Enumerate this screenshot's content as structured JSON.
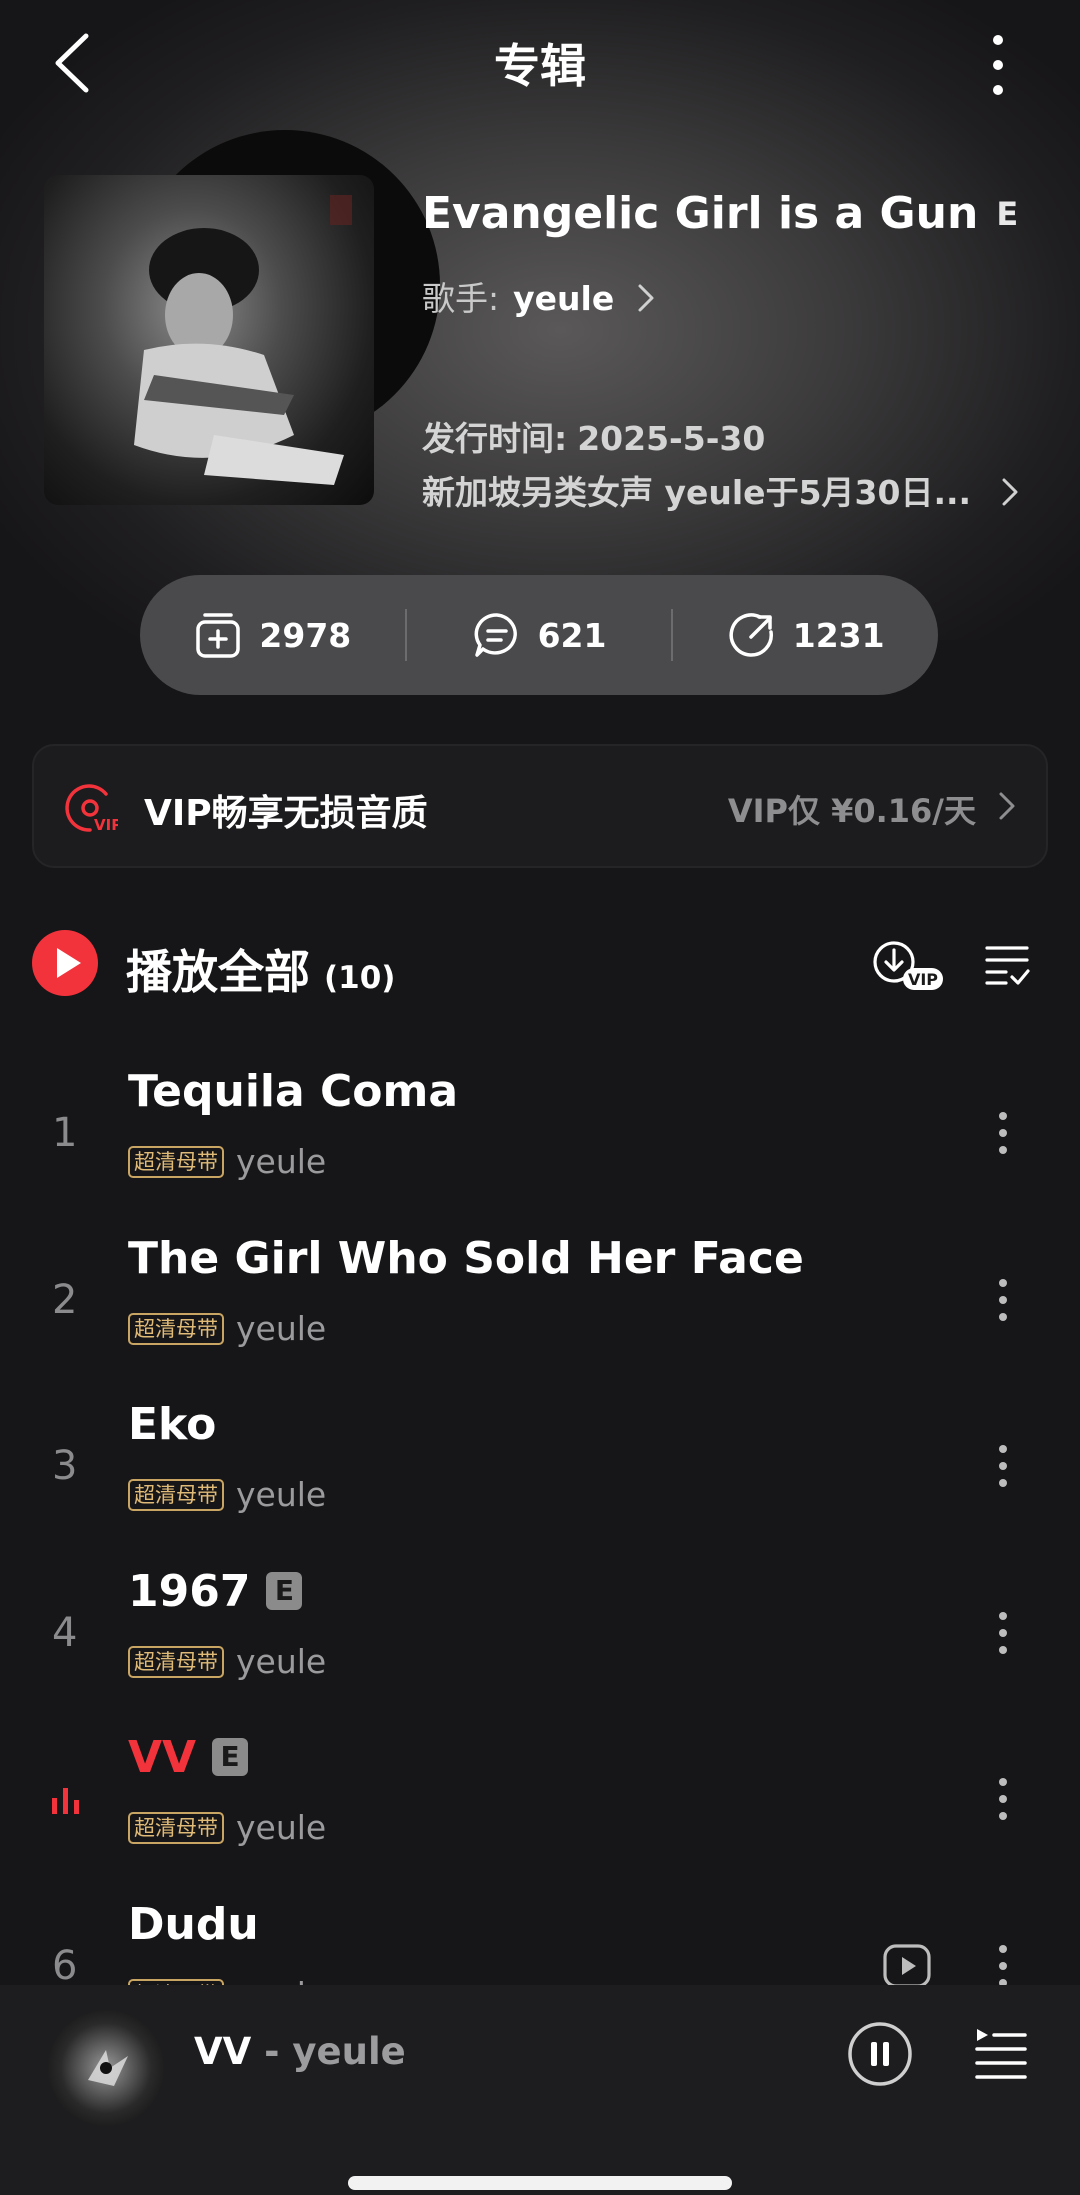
{
  "header": {
    "title": "专辑",
    "back_icon": "chevron-left-icon",
    "more_icon": "kebab-vertical-icon"
  },
  "album": {
    "title": "Evangelic Girl is a Gun",
    "explicit_mark": "E",
    "artist_label": "歌手:",
    "artist": "yeule",
    "release_label": "发行时间:",
    "release_date": "2025-5-30",
    "description": "新加坡另类女声 yeule于5月30日..."
  },
  "stats": {
    "collect_count": "2978",
    "comment_count": "621",
    "share_count": "1231"
  },
  "vip_banner": {
    "text": "VIP畅享无损音质",
    "price": "VIP仅 ¥0.16/天",
    "badge": "VIP"
  },
  "playlist": {
    "play_all_label": "播放全部",
    "count": "(10)",
    "download_badge": "VIP"
  },
  "tracks": [
    {
      "num": "1",
      "title": "Tequila Coma",
      "explicit": "",
      "tag": "超清母带",
      "artist": "yeule",
      "playing": false
    },
    {
      "num": "2",
      "title": "The Girl Who Sold Her Face",
      "explicit": "",
      "tag": "超清母带",
      "artist": "yeule",
      "playing": false
    },
    {
      "num": "3",
      "title": "Eko",
      "explicit": "",
      "tag": "超清母带",
      "artist": "yeule",
      "playing": false
    },
    {
      "num": "4",
      "title": "1967",
      "explicit": "E",
      "tag": "超清母带",
      "artist": "yeule",
      "playing": false
    },
    {
      "num": "",
      "title": "VV",
      "explicit": "E",
      "tag": "超清母带",
      "artist": "yeule",
      "playing": true
    },
    {
      "num": "6",
      "title": "Dudu",
      "explicit": "",
      "tag": "超清母带",
      "artist": "yeule",
      "playing": false
    }
  ],
  "player": {
    "title": "VV",
    "separator": "-",
    "artist": "yeule"
  },
  "colors": {
    "accent": "#f2333c",
    "gold_tag": "#e0bb78",
    "background": "#161517"
  }
}
